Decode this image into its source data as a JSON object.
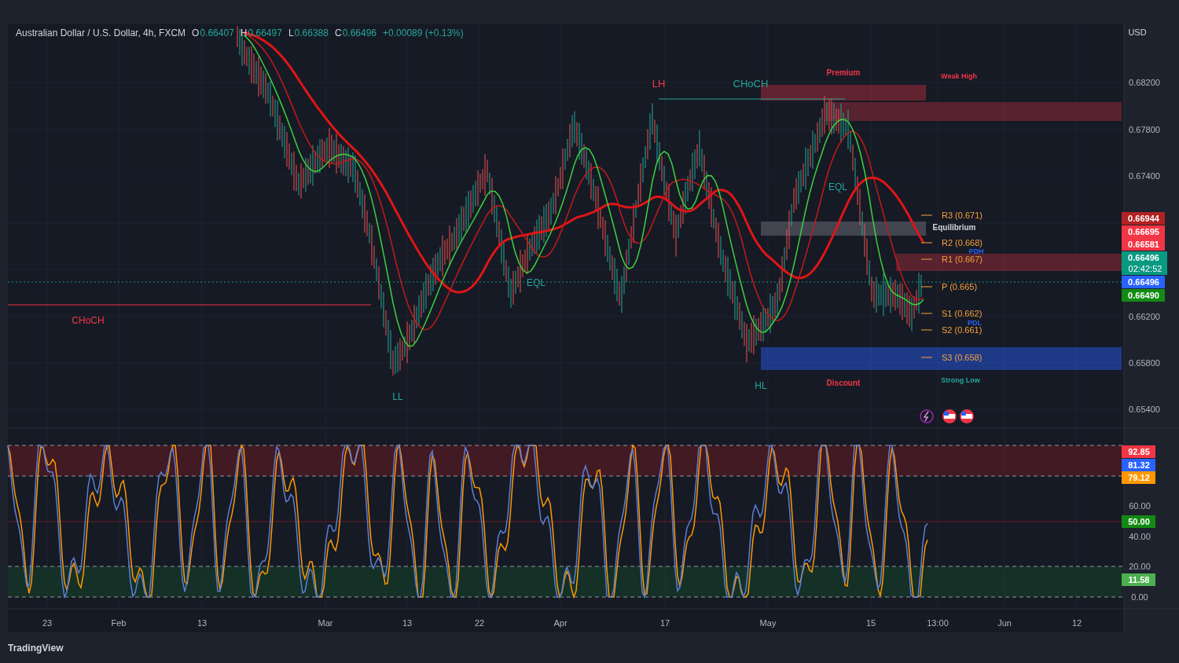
{
  "header": {
    "symbol": "Australian Dollar / U.S. Dollar, 4h, FXCM",
    "ohlc": [
      {
        "key": "O",
        "value": "0.66407"
      },
      {
        "key": "H",
        "value": "0.66497"
      },
      {
        "key": "L",
        "value": "0.66388"
      },
      {
        "key": "C",
        "value": "0.66496"
      }
    ],
    "change": "+0.00089 (+0.13%)"
  },
  "currency": "USD",
  "price_ticks": [
    "0.68200",
    "0.67800",
    "0.67400",
    "0.66200",
    "0.65800",
    "0.65400"
  ],
  "price_tags": [
    {
      "value": "0.66944",
      "color": "#b22222"
    },
    {
      "value": "0.66695",
      "color": "#f23645"
    },
    {
      "value": "0.66581",
      "color": "#f23645"
    },
    {
      "value": "0.66496",
      "countdown": "02:42:52",
      "color": "#089981"
    },
    {
      "value": "0.66496",
      "color": "#2962ff"
    },
    {
      "value": "0.66490",
      "color": "#138a13"
    }
  ],
  "pivots": [
    "R3 (0.671)",
    "R2 (0.668)",
    "R1 (0.667)",
    "P (0.665)",
    "S1 (0.662)",
    "S2 (0.661)",
    "S3 (0.658)"
  ],
  "chart_labels": [
    {
      "text": "Premium",
      "color": "#f23645"
    },
    {
      "text": "Weak High",
      "color": "#f23645"
    },
    {
      "text": "LH",
      "color": "#f23645"
    },
    {
      "text": "CHoCH",
      "color": "#26a69a"
    },
    {
      "text": "EQL",
      "color": "#26a69a"
    },
    {
      "text": "Equilibrium",
      "color": "#d1d4dc"
    },
    {
      "text": "PDH",
      "color": "#2962ff"
    },
    {
      "text": "EQL",
      "color": "#26a69a"
    },
    {
      "text": "CHoCH",
      "color": "#f23645"
    },
    {
      "text": "PDL",
      "color": "#2962ff"
    },
    {
      "text": "HL",
      "color": "#26a69a"
    },
    {
      "text": "Discount",
      "color": "#f23645"
    },
    {
      "text": "Strong Low",
      "color": "#26a69a"
    },
    {
      "text": "LL",
      "color": "#26a69a"
    }
  ],
  "oscillator_ticks": [
    "60.00",
    "40.00",
    "20.00",
    "0.00"
  ],
  "oscillator_tags": [
    {
      "value": "92.85",
      "color": "#f23645"
    },
    {
      "value": "81.32",
      "color": "#2962ff"
    },
    {
      "value": "79.12",
      "color": "#ff9800"
    },
    {
      "value": "50.00",
      "color": "#138a13"
    },
    {
      "value": "11.58",
      "color": "#4caf50"
    }
  ],
  "time_axis": [
    "23",
    "Feb",
    "13",
    "Mar",
    "13",
    "22",
    "Apr",
    "17",
    "May",
    "15",
    "13:00",
    "Jun",
    "12"
  ],
  "footer": "TradingView"
}
